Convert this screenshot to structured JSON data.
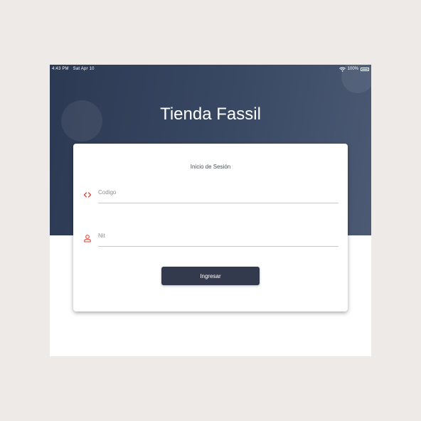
{
  "status_bar": {
    "time": "4:43 PM",
    "date": "Sat Apr 10",
    "battery": "100%",
    "wifi_icon": "wifi-icon",
    "battery_icon": "battery-icon"
  },
  "app": {
    "title": "Tienda Fassil"
  },
  "login": {
    "heading": "Inicio de Sesión",
    "codigo": {
      "placeholder": "Codigo",
      "value": "",
      "icon": "code-icon"
    },
    "nit": {
      "placeholder": "Nit",
      "value": "",
      "icon": "user-icon"
    },
    "submit_label": "Ingresar"
  },
  "colors": {
    "header": "#394863",
    "button": "#333a4d",
    "icon_accent": "#e0463c"
  }
}
